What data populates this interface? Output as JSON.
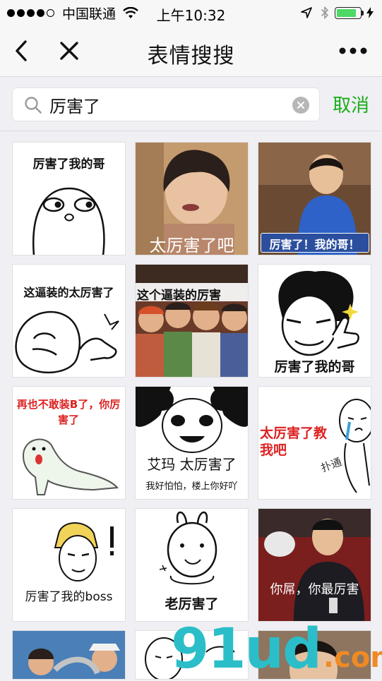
{
  "status_bar": {
    "carrier": "中国联通",
    "time": "上午10:32",
    "battery_level": 0.85
  },
  "nav": {
    "title": "表情搜搜",
    "icons": [
      "back-icon",
      "close-icon",
      "more-icon"
    ]
  },
  "search": {
    "query": "厉害了",
    "cancel_label": "取消"
  },
  "results": [
    {
      "caption": "厉害了我的哥"
    },
    {
      "caption": "太厉害了吧"
    },
    {
      "caption": "厉害了！我的哥！"
    },
    {
      "caption": "这逼装的太厉害了"
    },
    {
      "caption": "这个逼装的厉害"
    },
    {
      "caption": "厉害了我的哥"
    },
    {
      "caption": "再也不敢装B了，你厉害了"
    },
    {
      "caption": "艾玛 太厉害了",
      "subcaption": "我好怕怕，楼上你好吖"
    },
    {
      "caption": "太厉害了教我吧",
      "side_text": "扑通"
    },
    {
      "caption": "厉害了我的boss"
    },
    {
      "caption": "老厉害了"
    },
    {
      "caption": "你屌，你最厉害"
    }
  ],
  "watermark": {
    "main": "91ud",
    "suffix": ".com"
  },
  "colors": {
    "accent": "#1aad19",
    "background": "#efeff4"
  }
}
